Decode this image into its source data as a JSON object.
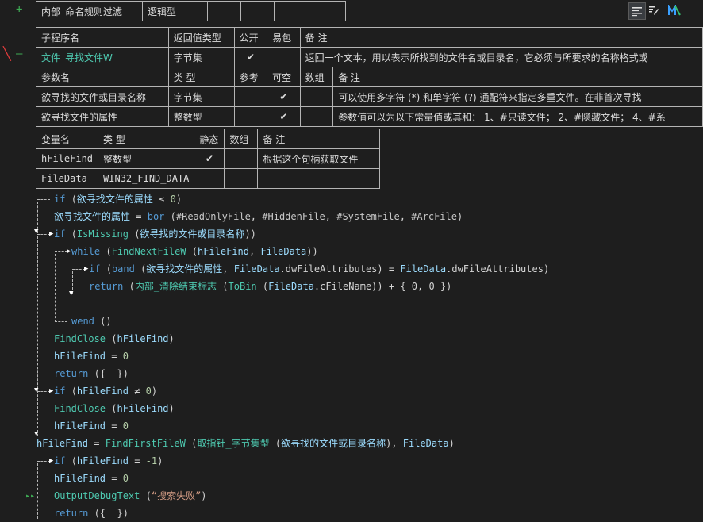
{
  "toolbar": {
    "icons": [
      "list-view-icon",
      "edit-icon",
      "mvm-logo-icon"
    ],
    "labels": [
      "☰",
      "✎",
      "M"
    ]
  },
  "gutter": {
    "plus_top": "+",
    "plus_row": "—",
    "bp": "\\"
  },
  "top_table": {
    "cells": [
      "内部_命名规则过滤",
      "逻辑型",
      "",
      "",
      ""
    ]
  },
  "sub_table": {
    "headers": [
      "子程序名",
      "返回值类型",
      "公开",
      "易包",
      "备 注"
    ],
    "row": {
      "name": "文件_寻找文件W",
      "ret": "字节集",
      "public": "✔",
      "easy": "",
      "note": "返回一个文本，用以表示所找到的文件名或目录名，它必须与所要求的名称格式或"
    }
  },
  "param_table": {
    "headers": [
      "参数名",
      "类 型",
      "参考",
      "可空",
      "数组",
      "备 注"
    ],
    "rows": [
      {
        "name": "欲寻找的文件或目录名称",
        "type": "字节集",
        "ref": "",
        "nullable": "✔",
        "arr": "",
        "note": "可以使用多字符 (*) 和单字符 (?) 通配符来指定多重文件。在非首次寻找"
      },
      {
        "name": "欲寻找文件的属性",
        "type": "整数型",
        "ref": "",
        "nullable": "✔",
        "arr": "",
        "note": "参数值可以为以下常量值或其和： 1、#只读文件； 2、#隐藏文件； 4、#系"
      }
    ]
  },
  "var_table": {
    "headers": [
      "变量名",
      "类 型",
      "静态",
      "数组",
      "备 注"
    ],
    "rows": [
      {
        "name": "hFileFind",
        "type": "整数型",
        "static": "✔",
        "arr": "",
        "note": "根据这个句柄获取文件"
      },
      {
        "name": "FileData",
        "type": "WIN32_FIND_DATA",
        "static": "",
        "arr": "",
        "note": ""
      }
    ]
  },
  "code": [
    "if (欲寻找文件的属性 ≤ 0)",
    "欲寻找文件的属性 = bor (#ReadOnlyFile, #HiddenFile, #SystemFile, #ArcFile)",
    "if (IsMissing (欲寻找的文件或目录名称))",
    "while (FindNextFileW (hFileFind, FileData))",
    "if (band (欲寻找文件的属性, FileData.dwFileAttributes) = FileData.dwFileAttributes)",
    "return (内部_清除结束标志 (ToBin (FileData.cFileName)) + { 0, 0 })",
    "",
    "wend ()",
    "FindClose (hFileFind)",
    "hFileFind = 0",
    "return ({ })",
    "if (hFileFind ≠ 0)",
    "FindClose (hFileFind)",
    "hFileFind = 0",
    "hFileFind = FindFirstFileW (取指针_字节集型 (欲寻找的文件或目录名称), FileData)",
    "if (hFileFind = -1)",
    "hFileFind = 0",
    "OutputDebugText (“搜索失败”)",
    "return ({ })"
  ]
}
